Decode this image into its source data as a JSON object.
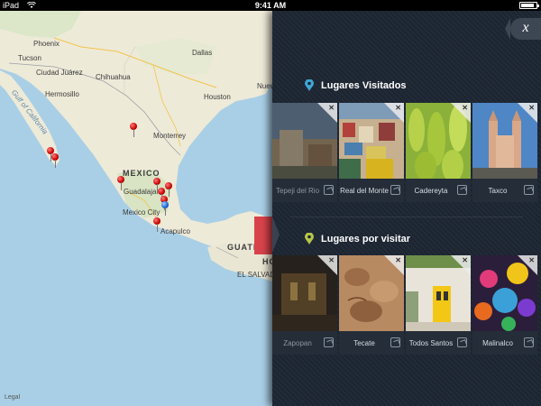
{
  "statusbar": {
    "carrier": "iPad",
    "time": "9:41 AM",
    "battery_level": 0.9
  },
  "map": {
    "labels": {
      "phoenix": "Phoenix",
      "tucson": "Tucson",
      "ciudad_juarez": "Ciudad Juárez",
      "hermosillo": "Hermosillo",
      "chihuahua": "Chihuahua",
      "gulf": "Gulf of California",
      "dallas": "Dallas",
      "houston": "Houston",
      "nuevo": "Nuevo",
      "monterrey": "Monterrey",
      "mexico": "MEXICO",
      "guadalajara": "Guadalajara",
      "mexico_city": "Mexico City",
      "acapulco": "Acapulco",
      "guatemala": "GUATEMALA",
      "honduras": "HONDURAS",
      "salvador": "EL SALVADOR"
    },
    "legal": "Legal"
  },
  "panel": {
    "close_label": "x",
    "visited": {
      "title": "Lugares Visitados",
      "items": [
        {
          "name": "Tepeji del Rio",
          "faded": true
        },
        {
          "name": "Real del Monte",
          "faded": false
        },
        {
          "name": "Cadereyta",
          "faded": false
        },
        {
          "name": "Taxco",
          "faded": false
        }
      ]
    },
    "to_visit": {
      "title": "Lugares por visitar",
      "items": [
        {
          "name": "Zapopan",
          "faded": true
        },
        {
          "name": "Tecate",
          "faded": false
        },
        {
          "name": "Todos Santos",
          "faded": false
        },
        {
          "name": "Malinalco",
          "faded": false
        }
      ]
    },
    "colors": {
      "visited_marker": "#3fa7d6",
      "to_visit_marker": "#b7c64a",
      "accent": "#d8434b"
    }
  }
}
